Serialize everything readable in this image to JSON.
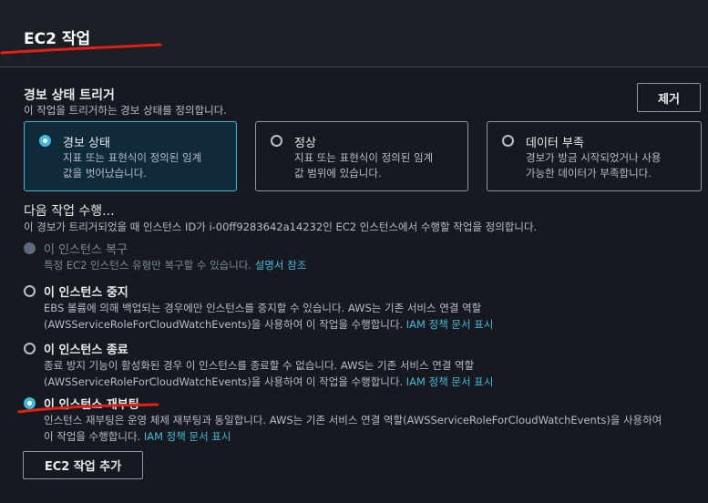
{
  "header": {
    "title": "EC2 작업"
  },
  "trigger": {
    "title": "경보 상태 트리거",
    "desc": "이 작업을 트리거하는 경보 상태를 정의합니다.",
    "remove_label": "제거",
    "tiles": [
      {
        "label": "경보 상태",
        "desc1": "지표 또는 표현식이 정의된 임계",
        "desc2": "값을 벗어났습니다."
      },
      {
        "label": "정상",
        "desc1": "지표 또는 표현식이 정의된 임계",
        "desc2": "값 범위에 있습니다."
      },
      {
        "label": "데이터 부족",
        "desc1": "경보가 방금 시작되었거나 사용",
        "desc2": "가능한 데이터가 부족합니다."
      }
    ]
  },
  "action": {
    "title": "다음 작업 수행...",
    "desc": "이 경보가 트리거되었을 때 인스턴스 ID가 i-00ff9283642a14232인 EC2 인스턴스에서 수행할 작업을 정의합니다.",
    "options": [
      {
        "label": "이 인스턴스 복구",
        "desc1": "특정 EC2 인스턴스 유형만 복구할 수 있습니다. ",
        "link": "설명서 참조"
      },
      {
        "label": "이 인스턴스 중지",
        "desc1": "EBS 볼륨에 의해 백업되는 경우에만 인스턴스를 중지할 수 있습니다. AWS는 기존 서비스 연결 역할",
        "desc2": "(AWSServiceRoleForCloudWatchEvents)을 사용하여 이 작업을 수행합니다. ",
        "link": "IAM 정책 문서 표시"
      },
      {
        "label": "이 인스턴스 종료",
        "desc1": "종료 방지 기능이 활성화된 경우 이 인스턴스를 종료할 수 없습니다. AWS는 기존 서비스 연결 역할",
        "desc2": "(AWSServiceRoleForCloudWatchEvents)을 사용하여 이 작업을 수행합니다. ",
        "link": "IAM 정책 문서 표시"
      },
      {
        "label": "이 인스턴스 재부팅",
        "desc1": "인스턴스 재부팅은 운영 체제 재부팅과 동일합니다. AWS는 기존 서비스 연결 역할(AWSServiceRoleForCloudWatchEvents)을 사용하여",
        "desc2": "이 작업을 수행합니다. ",
        "link": "IAM 정책 문서 표시"
      }
    ],
    "add_label": "EC2 작업 추가"
  },
  "colors": {
    "accent": "#44b9d6",
    "annotation": "#e0201a"
  }
}
